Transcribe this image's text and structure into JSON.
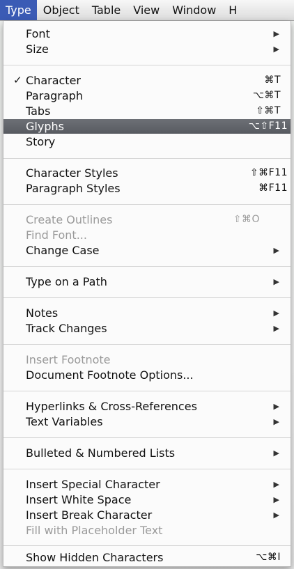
{
  "menubar": {
    "items": [
      "Type",
      "Object",
      "Table",
      "View",
      "Window",
      "H"
    ]
  },
  "menu": {
    "font": "Font",
    "size": "Size",
    "character": "Character",
    "character_sc": "⌘T",
    "paragraph": "Paragraph",
    "paragraph_sc": "⌥⌘T",
    "tabs": "Tabs",
    "tabs_sc": "⇧⌘T",
    "glyphs": "Glyphs",
    "glyphs_sc": "⌥⇧F11",
    "story": "Story",
    "character_styles": "Character Styles",
    "character_styles_sc": "⇧⌘F11",
    "paragraph_styles": "Paragraph Styles",
    "paragraph_styles_sc": "⌘F11",
    "create_outlines": "Create Outlines",
    "create_outlines_sc": "⇧⌘O",
    "find_font": "Find Font...",
    "change_case": "Change Case",
    "type_on_path": "Type on a Path",
    "notes": "Notes",
    "track_changes": "Track Changes",
    "insert_footnote": "Insert Footnote",
    "doc_footnote_options": "Document Footnote Options...",
    "hyperlinks": "Hyperlinks & Cross-References",
    "text_variables": "Text Variables",
    "bulleted_lists": "Bulleted & Numbered Lists",
    "insert_special_char": "Insert Special Character",
    "insert_white_space": "Insert White Space",
    "insert_break_char": "Insert Break Character",
    "fill_placeholder": "Fill with Placeholder Text",
    "show_hidden": "Show Hidden Characters",
    "show_hidden_sc": "⌥⌘I",
    "check_mark": "✓",
    "submenu_arrow": "▶"
  }
}
